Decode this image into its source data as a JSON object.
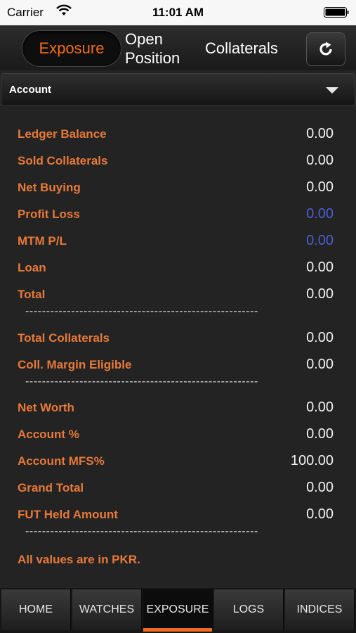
{
  "status": {
    "carrier": "Carrier",
    "time": "11:01 AM"
  },
  "tabs": {
    "exposure": "Exposure",
    "open_line1": "Open",
    "open_line2": "Position",
    "collaterals": "Collaterals"
  },
  "account": {
    "label": "Account"
  },
  "rows": [
    {
      "label": "Ledger Balance",
      "value": "0.00"
    },
    {
      "label": "Sold Collaterals",
      "value": "0.00"
    },
    {
      "label": "Net Buying",
      "value": "0.00"
    },
    {
      "label": "Profit Loss",
      "value": "0.00"
    },
    {
      "label": "MTM P/L",
      "value": "0.00"
    },
    {
      "label": "Loan",
      "value": "0.00"
    },
    {
      "label": "Total",
      "value": "0.00"
    },
    {
      "label": "Total Collaterals",
      "value": "0.00"
    },
    {
      "label": "Coll. Margin Eligible",
      "value": "0.00"
    },
    {
      "label": "Net Worth",
      "value": "0.00"
    },
    {
      "label": "Account %",
      "value": "0.00"
    },
    {
      "label": "Account MFS%",
      "value": "100.00"
    },
    {
      "label": "Grand Total",
      "value": "0.00"
    },
    {
      "label": "FUT Held Amount",
      "value": "0.00"
    }
  ],
  "separator": "--------------------------------------------------------",
  "note": "All values are in PKR.",
  "nav": [
    "HOME",
    "WATCHES",
    "EXPOSURE",
    "LOGS",
    "INDICES"
  ],
  "colors": {
    "accent": "#f26b21",
    "label": "#e8793a",
    "negative_link": "#4d5fd1",
    "background": "#232323"
  },
  "icons": {
    "refresh": "refresh-icon",
    "dropdown": "caret-down-icon",
    "wifi": "wifi-icon",
    "battery": "battery-icon"
  }
}
